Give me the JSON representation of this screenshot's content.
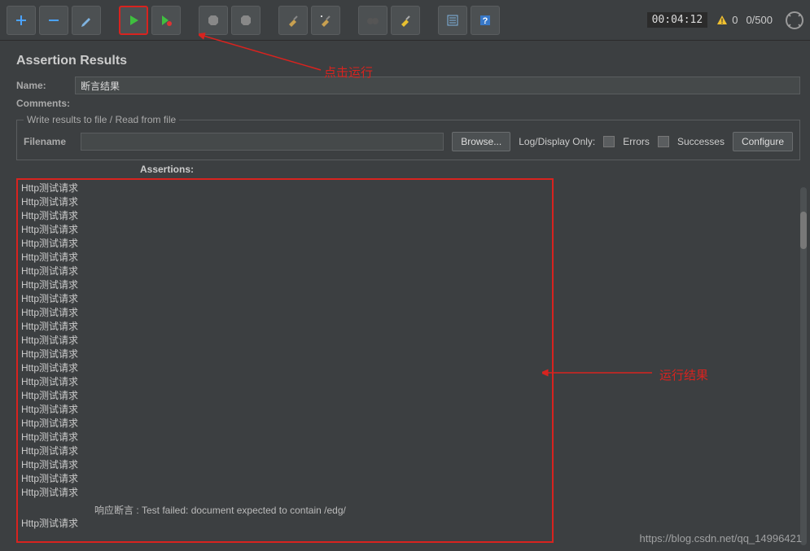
{
  "toolbar": {
    "timer": "00:04:12",
    "warn_count": "0",
    "progress": "0/500"
  },
  "panel": {
    "title": "Assertion Results",
    "name_label": "Name:",
    "name_value": "断言结果",
    "comments_label": "Comments:"
  },
  "file_group": {
    "legend": "Write results to file / Read from file",
    "filename_label": "Filename",
    "filename_value": "",
    "browse": "Browse...",
    "log_only": "Log/Display Only:",
    "errors": "Errors",
    "successes": "Successes",
    "configure": "Configure"
  },
  "assertions": {
    "heading": "Assertions:",
    "item_label": "Http测试请求",
    "count": 23,
    "failure": "响应断言 : Test failed: document expected to contain /edg/"
  },
  "annotations": {
    "run_click": "点击运行",
    "run_result": "运行结果"
  },
  "watermark": "https://blog.csdn.net/qq_14996421"
}
